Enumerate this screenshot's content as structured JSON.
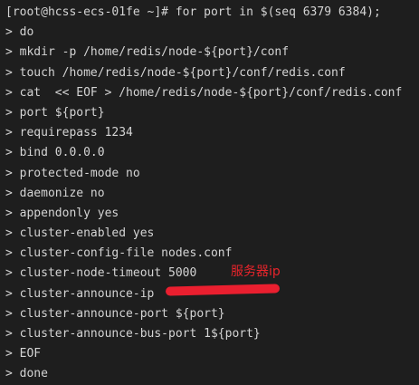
{
  "terminal": {
    "lines": [
      "[root@hcss-ecs-01fe ~]# for port in $(seq 6379 6384);",
      "> do",
      "> mkdir -p /home/redis/node-${port}/conf",
      "> touch /home/redis/node-${port}/conf/redis.conf",
      "> cat  << EOF > /home/redis/node-${port}/conf/redis.conf",
      "> port ${port}",
      "> requirepass 1234",
      "> bind 0.0.0.0",
      "> protected-mode no",
      "> daemonize no",
      "> appendonly yes",
      "> cluster-enabled yes",
      "> cluster-config-file nodes.conf",
      "> cluster-node-timeout 5000",
      "> cluster-announce-ip",
      "> cluster-announce-port ${port}",
      "> cluster-announce-bus-port 1${port}",
      "> EOF",
      "> done"
    ]
  },
  "annotation": {
    "text": "服务器ip",
    "color": "#e8242b"
  },
  "colors": {
    "background": "#1e1e1e",
    "foreground": "#d4d4d4",
    "redaction": "#ea1f2f"
  }
}
